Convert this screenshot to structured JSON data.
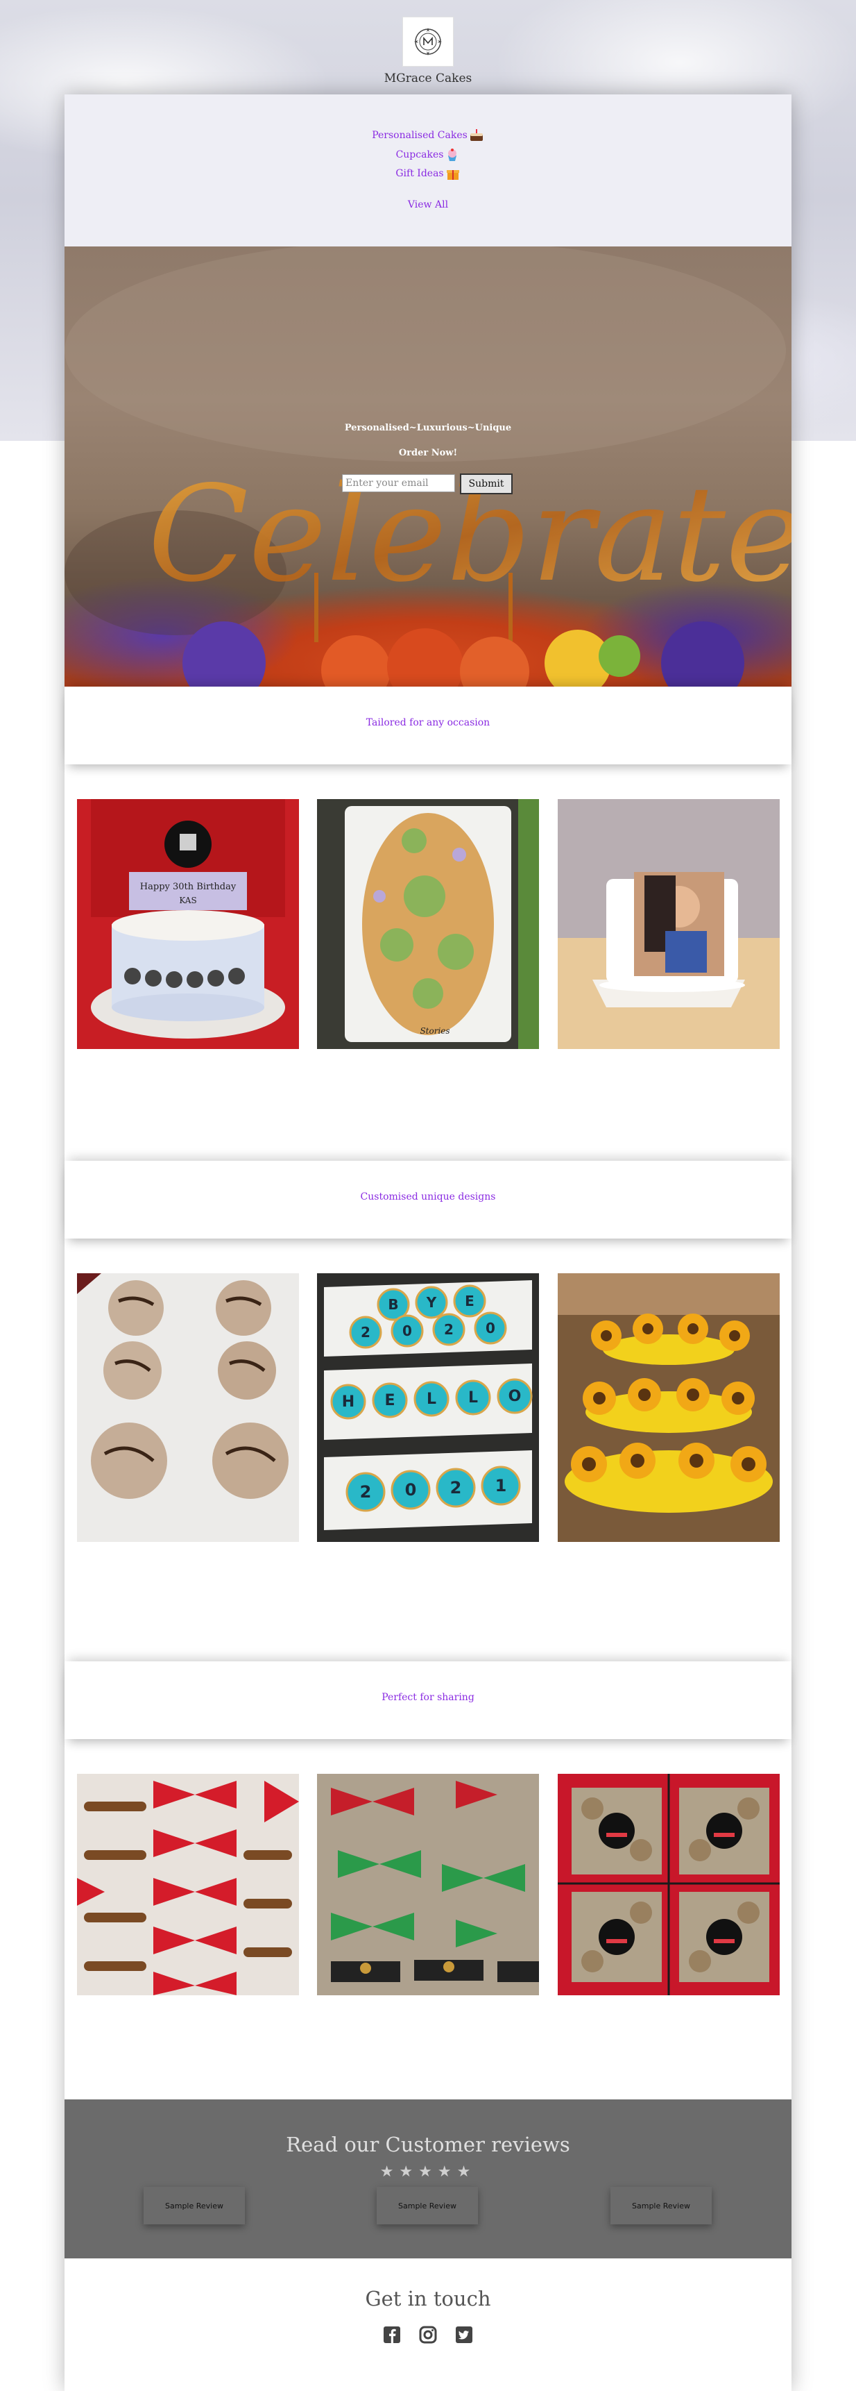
{
  "brand": {
    "name": "MGrace Cakes"
  },
  "nav": {
    "items": [
      {
        "label": "Personalised Cakes",
        "icon": "cake-icon"
      },
      {
        "label": "Cupcakes",
        "icon": "cupcake-icon"
      },
      {
        "label": "Gift Ideas",
        "icon": "gift-icon"
      }
    ],
    "view_all": "View All"
  },
  "hero": {
    "tagline": "Personalised~Luxurious~Unique",
    "order_now": "Order Now!",
    "email_placeholder": "Enter your email",
    "submit_label": "Submit",
    "topper_text": "Celebrate"
  },
  "sections": [
    {
      "title": "Tailored for any occasion"
    },
    {
      "title": "Customised unique designs"
    },
    {
      "title": "Perfect for sharing"
    }
  ],
  "cake_labels": {
    "birthday_line1": "Happy 30th Birthday",
    "birthday_line2": "KAS",
    "cookie_note": "Stories"
  },
  "cookie_letters": {
    "row1": [
      "B",
      "Y",
      "E"
    ],
    "row2": [
      "2",
      "0",
      "2",
      "0"
    ],
    "row3": [
      "H",
      "E",
      "L",
      "L",
      "O"
    ],
    "row4": [
      "2",
      "0",
      "2",
      "1"
    ]
  },
  "reviews": {
    "title": "Read our Customer reviews",
    "stars": "★★★★★",
    "cards": [
      "Sample Review",
      "Sample Review",
      "Sample Review"
    ]
  },
  "contact": {
    "title": "Get in touch",
    "social": [
      "facebook-icon",
      "instagram-icon",
      "twitter-icon"
    ]
  },
  "colors": {
    "accent": "#8a2be2",
    "reviews_bg": "#6b6b6b"
  }
}
